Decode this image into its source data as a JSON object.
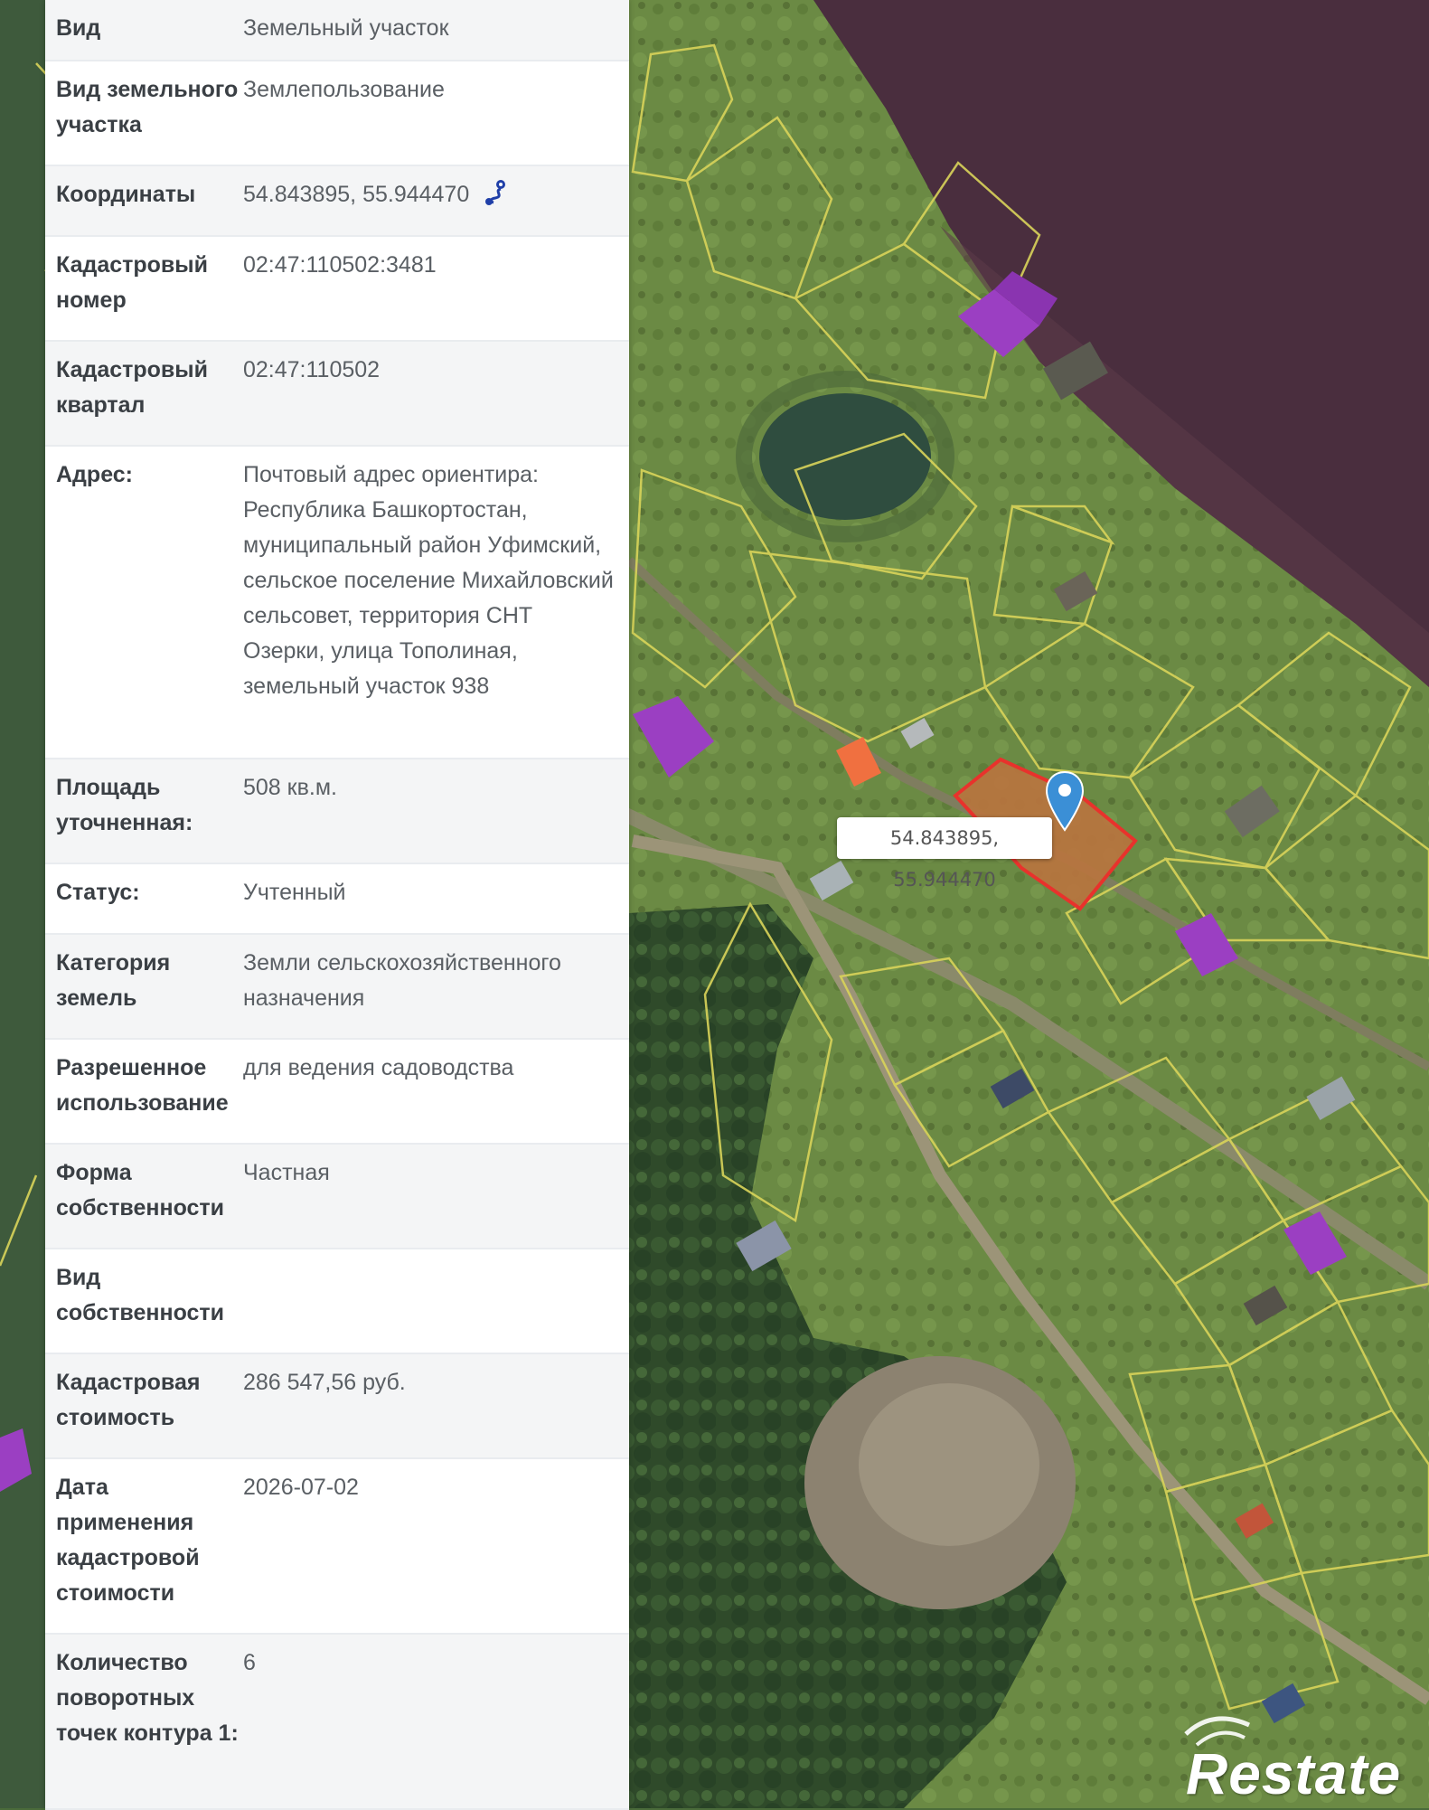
{
  "panel": {
    "rows": [
      {
        "label": "Вид",
        "value": "Земельный участок"
      },
      {
        "label": "Вид земельного участка",
        "value": "Землепользование"
      },
      {
        "label": "Координаты",
        "value": "54.843895, 55.944470"
      },
      {
        "label": "Кадастровый номер",
        "value": "02:47:110502:3481"
      },
      {
        "label": "Кадастровый квартал",
        "value": "02:47:110502"
      },
      {
        "label": "Адрес:",
        "value": "Почтовый адрес ориентира: Республика Башкортостан, муниципальный район Уфимский, сельское поселение Михайловский сельсовет, территория СНТ Озерки, улица Тополиная, земельный участок 938"
      },
      {
        "label": "Площадь уточненная:",
        "value": "508 кв.м."
      },
      {
        "label": "Статус:",
        "value": "Учтенный"
      },
      {
        "label": "Категория земель",
        "value": "Земли сельскохозяйственного назначения"
      },
      {
        "label": "Разрешенное использование",
        "value": "для ведения садоводства"
      },
      {
        "label": "Форма собственности",
        "value": "Частная"
      },
      {
        "label": "Вид собственности",
        "value": ""
      },
      {
        "label": "Кадастровая стоимость",
        "value": "286 547,56 руб."
      },
      {
        "label": "Дата применения кадастровой стоимости",
        "value": "2026-07-02"
      },
      {
        "label": "Количество поворотных точек контура 1:",
        "value": "6"
      }
    ],
    "coordinates_icon": "route-map-icon"
  },
  "map": {
    "popup_text": "54.843895, 55.944470",
    "pin_icon": "map-pin-icon",
    "watermark": "Restate",
    "colors": {
      "parcel_outline": "#e8322c",
      "parcel_fill": "#b8743f",
      "plot_lines": "#d9d45a",
      "pin": "#3b8fd6",
      "roof_purple": "#9b3fc2",
      "roof_orange": "#f07040",
      "field_dark": "#4a2e3e",
      "field_dark_alt": "#5b3a4a",
      "water": "#2f4d3f",
      "forest": "#2f4a2a"
    }
  }
}
